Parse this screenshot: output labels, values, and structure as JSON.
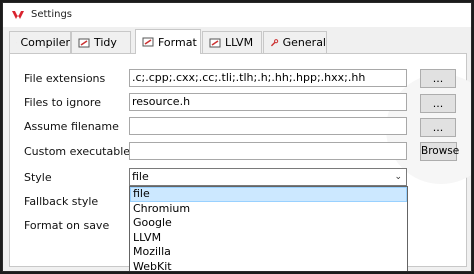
{
  "window": {
    "title": "Settings"
  },
  "tabs": [
    {
      "label": "Compiler",
      "icon": "compiler-icon"
    },
    {
      "label": "Tidy",
      "icon": "tidy-icon"
    },
    {
      "label": "Format",
      "icon": "format-icon",
      "active": true
    },
    {
      "label": "LLVM",
      "icon": "llvm-icon"
    },
    {
      "label": "General",
      "icon": "wrench-icon"
    }
  ],
  "form": {
    "file_extensions": {
      "label": "File extensions",
      "value": ".c;.cpp;.cxx;.cc;.tli;.tlh;.h;.hh;.hpp;.hxx;.hh",
      "button": "..."
    },
    "files_to_ignore": {
      "label": "Files to ignore",
      "value": "resource.h",
      "button": "..."
    },
    "assume_filename": {
      "label": "Assume filename",
      "value": "",
      "button": "..."
    },
    "custom_executable": {
      "label": "Custom executable",
      "value": "",
      "button": "Browse"
    },
    "style": {
      "label": "Style",
      "value": "file",
      "options": [
        "file",
        "Chromium",
        "Google",
        "LLVM",
        "Mozilla",
        "WebKit"
      ]
    },
    "fallback_style": {
      "label": "Fallback style"
    },
    "format_on_save": {
      "label": "Format on save"
    }
  },
  "colors": {
    "accent": "#cce8ff",
    "app_icon": "#d9232e"
  }
}
